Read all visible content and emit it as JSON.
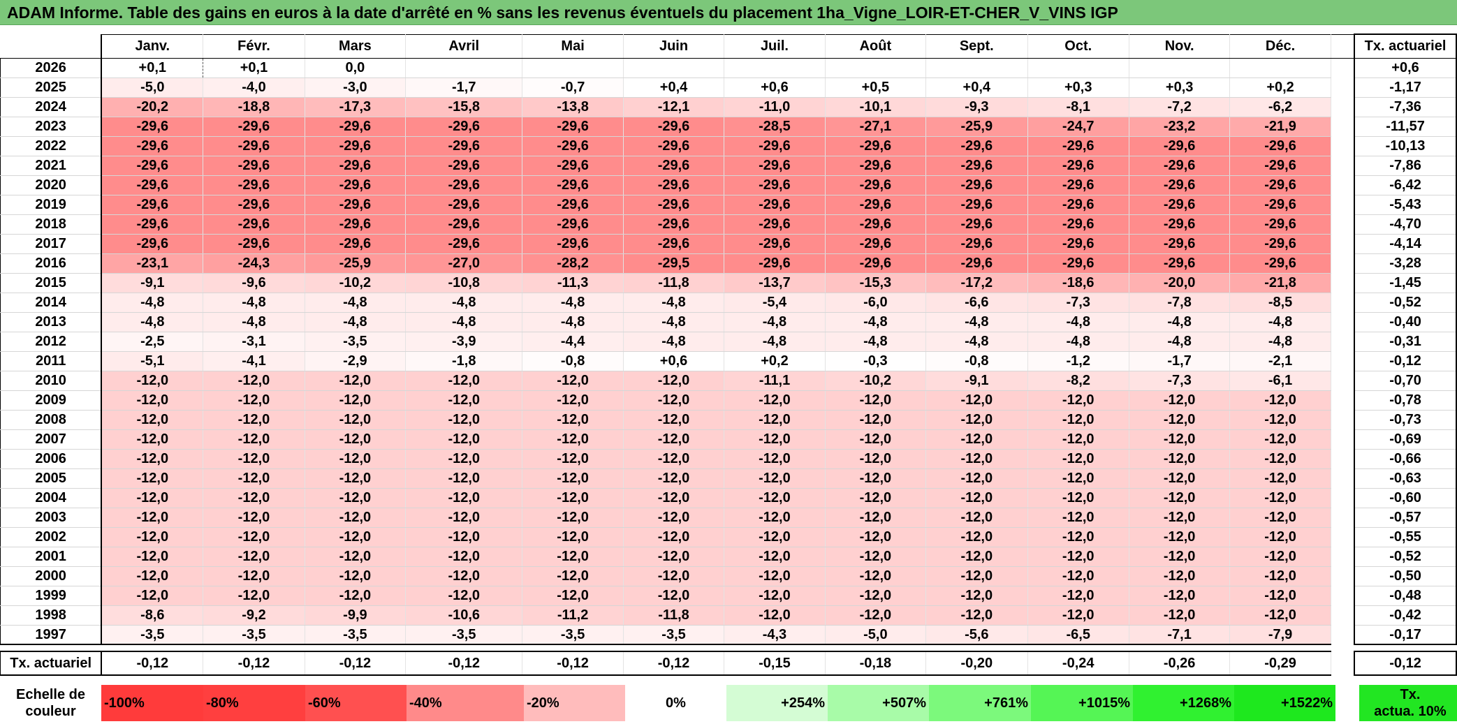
{
  "title": "ADAM Informe. Table des gains en euros à la date d'arrêté en % sans les revenus éventuels du placement 1ha_Vigne_LOIR-ET-CHER_V_VINS IGP",
  "months": [
    "Janv.",
    "Févr.",
    "Mars",
    "Avril",
    "Mai",
    "Juin",
    "Juil.",
    "Août",
    "Sept.",
    "Oct.",
    "Nov.",
    "Déc."
  ],
  "tx_header": "Tx. actuariel",
  "rows": [
    {
      "year": "2026",
      "values": [
        "+0,1",
        "+0,1",
        "0,0",
        "",
        "",
        "",
        "",
        "",
        "",
        "",
        "",
        ""
      ],
      "tx": "+0,6"
    },
    {
      "year": "2025",
      "values": [
        "-5,0",
        "-4,0",
        "-3,0",
        "-1,7",
        "-0,7",
        "+0,4",
        "+0,6",
        "+0,5",
        "+0,4",
        "+0,3",
        "+0,3",
        "+0,2"
      ],
      "tx": "-1,17"
    },
    {
      "year": "2024",
      "values": [
        "-20,2",
        "-18,8",
        "-17,3",
        "-15,8",
        "-13,8",
        "-12,1",
        "-11,0",
        "-10,1",
        "-9,3",
        "-8,1",
        "-7,2",
        "-6,2"
      ],
      "tx": "-7,36"
    },
    {
      "year": "2023",
      "values": [
        "-29,6",
        "-29,6",
        "-29,6",
        "-29,6",
        "-29,6",
        "-29,6",
        "-28,5",
        "-27,1",
        "-25,9",
        "-24,7",
        "-23,2",
        "-21,9"
      ],
      "tx": "-11,57"
    },
    {
      "year": "2022",
      "values": [
        "-29,6",
        "-29,6",
        "-29,6",
        "-29,6",
        "-29,6",
        "-29,6",
        "-29,6",
        "-29,6",
        "-29,6",
        "-29,6",
        "-29,6",
        "-29,6"
      ],
      "tx": "-10,13"
    },
    {
      "year": "2021",
      "values": [
        "-29,6",
        "-29,6",
        "-29,6",
        "-29,6",
        "-29,6",
        "-29,6",
        "-29,6",
        "-29,6",
        "-29,6",
        "-29,6",
        "-29,6",
        "-29,6"
      ],
      "tx": "-7,86"
    },
    {
      "year": "2020",
      "values": [
        "-29,6",
        "-29,6",
        "-29,6",
        "-29,6",
        "-29,6",
        "-29,6",
        "-29,6",
        "-29,6",
        "-29,6",
        "-29,6",
        "-29,6",
        "-29,6"
      ],
      "tx": "-6,42"
    },
    {
      "year": "2019",
      "values": [
        "-29,6",
        "-29,6",
        "-29,6",
        "-29,6",
        "-29,6",
        "-29,6",
        "-29,6",
        "-29,6",
        "-29,6",
        "-29,6",
        "-29,6",
        "-29,6"
      ],
      "tx": "-5,43"
    },
    {
      "year": "2018",
      "values": [
        "-29,6",
        "-29,6",
        "-29,6",
        "-29,6",
        "-29,6",
        "-29,6",
        "-29,6",
        "-29,6",
        "-29,6",
        "-29,6",
        "-29,6",
        "-29,6"
      ],
      "tx": "-4,70"
    },
    {
      "year": "2017",
      "values": [
        "-29,6",
        "-29,6",
        "-29,6",
        "-29,6",
        "-29,6",
        "-29,6",
        "-29,6",
        "-29,6",
        "-29,6",
        "-29,6",
        "-29,6",
        "-29,6"
      ],
      "tx": "-4,14"
    },
    {
      "year": "2016",
      "values": [
        "-23,1",
        "-24,3",
        "-25,9",
        "-27,0",
        "-28,2",
        "-29,5",
        "-29,6",
        "-29,6",
        "-29,6",
        "-29,6",
        "-29,6",
        "-29,6"
      ],
      "tx": "-3,28"
    },
    {
      "year": "2015",
      "values": [
        "-9,1",
        "-9,6",
        "-10,2",
        "-10,8",
        "-11,3",
        "-11,8",
        "-13,7",
        "-15,3",
        "-17,2",
        "-18,6",
        "-20,0",
        "-21,8"
      ],
      "tx": "-1,45"
    },
    {
      "year": "2014",
      "values": [
        "-4,8",
        "-4,8",
        "-4,8",
        "-4,8",
        "-4,8",
        "-4,8",
        "-5,4",
        "-6,0",
        "-6,6",
        "-7,3",
        "-7,8",
        "-8,5"
      ],
      "tx": "-0,52"
    },
    {
      "year": "2013",
      "values": [
        "-4,8",
        "-4,8",
        "-4,8",
        "-4,8",
        "-4,8",
        "-4,8",
        "-4,8",
        "-4,8",
        "-4,8",
        "-4,8",
        "-4,8",
        "-4,8"
      ],
      "tx": "-0,40"
    },
    {
      "year": "2012",
      "values": [
        "-2,5",
        "-3,1",
        "-3,5",
        "-3,9",
        "-4,4",
        "-4,8",
        "-4,8",
        "-4,8",
        "-4,8",
        "-4,8",
        "-4,8",
        "-4,8"
      ],
      "tx": "-0,31"
    },
    {
      "year": "2011",
      "values": [
        "-5,1",
        "-4,1",
        "-2,9",
        "-1,8",
        "-0,8",
        "+0,6",
        "+0,2",
        "-0,3",
        "-0,8",
        "-1,2",
        "-1,7",
        "-2,1"
      ],
      "tx": "-0,12"
    },
    {
      "year": "2010",
      "values": [
        "-12,0",
        "-12,0",
        "-12,0",
        "-12,0",
        "-12,0",
        "-12,0",
        "-11,1",
        "-10,2",
        "-9,1",
        "-8,2",
        "-7,3",
        "-6,1"
      ],
      "tx": "-0,70"
    },
    {
      "year": "2009",
      "values": [
        "-12,0",
        "-12,0",
        "-12,0",
        "-12,0",
        "-12,0",
        "-12,0",
        "-12,0",
        "-12,0",
        "-12,0",
        "-12,0",
        "-12,0",
        "-12,0"
      ],
      "tx": "-0,78"
    },
    {
      "year": "2008",
      "values": [
        "-12,0",
        "-12,0",
        "-12,0",
        "-12,0",
        "-12,0",
        "-12,0",
        "-12,0",
        "-12,0",
        "-12,0",
        "-12,0",
        "-12,0",
        "-12,0"
      ],
      "tx": "-0,73"
    },
    {
      "year": "2007",
      "values": [
        "-12,0",
        "-12,0",
        "-12,0",
        "-12,0",
        "-12,0",
        "-12,0",
        "-12,0",
        "-12,0",
        "-12,0",
        "-12,0",
        "-12,0",
        "-12,0"
      ],
      "tx": "-0,69"
    },
    {
      "year": "2006",
      "values": [
        "-12,0",
        "-12,0",
        "-12,0",
        "-12,0",
        "-12,0",
        "-12,0",
        "-12,0",
        "-12,0",
        "-12,0",
        "-12,0",
        "-12,0",
        "-12,0"
      ],
      "tx": "-0,66"
    },
    {
      "year": "2005",
      "values": [
        "-12,0",
        "-12,0",
        "-12,0",
        "-12,0",
        "-12,0",
        "-12,0",
        "-12,0",
        "-12,0",
        "-12,0",
        "-12,0",
        "-12,0",
        "-12,0"
      ],
      "tx": "-0,63"
    },
    {
      "year": "2004",
      "values": [
        "-12,0",
        "-12,0",
        "-12,0",
        "-12,0",
        "-12,0",
        "-12,0",
        "-12,0",
        "-12,0",
        "-12,0",
        "-12,0",
        "-12,0",
        "-12,0"
      ],
      "tx": "-0,60"
    },
    {
      "year": "2003",
      "values": [
        "-12,0",
        "-12,0",
        "-12,0",
        "-12,0",
        "-12,0",
        "-12,0",
        "-12,0",
        "-12,0",
        "-12,0",
        "-12,0",
        "-12,0",
        "-12,0"
      ],
      "tx": "-0,57"
    },
    {
      "year": "2002",
      "values": [
        "-12,0",
        "-12,0",
        "-12,0",
        "-12,0",
        "-12,0",
        "-12,0",
        "-12,0",
        "-12,0",
        "-12,0",
        "-12,0",
        "-12,0",
        "-12,0"
      ],
      "tx": "-0,55"
    },
    {
      "year": "2001",
      "values": [
        "-12,0",
        "-12,0",
        "-12,0",
        "-12,0",
        "-12,0",
        "-12,0",
        "-12,0",
        "-12,0",
        "-12,0",
        "-12,0",
        "-12,0",
        "-12,0"
      ],
      "tx": "-0,52"
    },
    {
      "year": "2000",
      "values": [
        "-12,0",
        "-12,0",
        "-12,0",
        "-12,0",
        "-12,0",
        "-12,0",
        "-12,0",
        "-12,0",
        "-12,0",
        "-12,0",
        "-12,0",
        "-12,0"
      ],
      "tx": "-0,50"
    },
    {
      "year": "1999",
      "values": [
        "-12,0",
        "-12,0",
        "-12,0",
        "-12,0",
        "-12,0",
        "-12,0",
        "-12,0",
        "-12,0",
        "-12,0",
        "-12,0",
        "-12,0",
        "-12,0"
      ],
      "tx": "-0,48"
    },
    {
      "year": "1998",
      "values": [
        "-8,6",
        "-9,2",
        "-9,9",
        "-10,6",
        "-11,2",
        "-11,8",
        "-12,0",
        "-12,0",
        "-12,0",
        "-12,0",
        "-12,0",
        "-12,0"
      ],
      "tx": "-0,42"
    },
    {
      "year": "1997",
      "values": [
        "-3,5",
        "-3,5",
        "-3,5",
        "-3,5",
        "-3,5",
        "-3,5",
        "-4,3",
        "-5,0",
        "-5,6",
        "-6,5",
        "-7,1",
        "-7,9"
      ],
      "tx": "-0,17"
    }
  ],
  "summary": {
    "label": "Tx. actuariel",
    "values": [
      "-0,12",
      "-0,12",
      "-0,12",
      "-0,12",
      "-0,12",
      "-0,12",
      "-0,15",
      "-0,18",
      "-0,20",
      "-0,24",
      "-0,26",
      "-0,29"
    ],
    "tx": "-0,12"
  },
  "scale": {
    "label_line1": "Echelle de",
    "label_line2": "couleur",
    "items": [
      {
        "text": "-100%",
        "color": "#ff3b3b",
        "align": "left"
      },
      {
        "text": "-80%",
        "color": "#ff3f3f",
        "align": "left"
      },
      {
        "text": "-60%",
        "color": "#ff5050",
        "align": "left"
      },
      {
        "text": "-40%",
        "color": "#ff8a8a",
        "align": "left"
      },
      {
        "text": "-20%",
        "color": "#ffbcbc",
        "align": "left"
      },
      {
        "text": "0%",
        "color": "#ffffff",
        "align": "center"
      },
      {
        "text": "+254%",
        "color": "#d4fcd4",
        "align": "right"
      },
      {
        "text": "+507%",
        "color": "#a8fba8",
        "align": "right"
      },
      {
        "text": "+761%",
        "color": "#7cf97c",
        "align": "right"
      },
      {
        "text": "+1015%",
        "color": "#55f555",
        "align": "right"
      },
      {
        "text": "+1268%",
        "color": "#30f130",
        "align": "right"
      },
      {
        "text": "+1522%",
        "color": "#1ee81e",
        "align": "right"
      }
    ],
    "tx_line1": "Tx.",
    "tx_line2": "actua. 10%",
    "tx_color": "#22e622"
  }
}
